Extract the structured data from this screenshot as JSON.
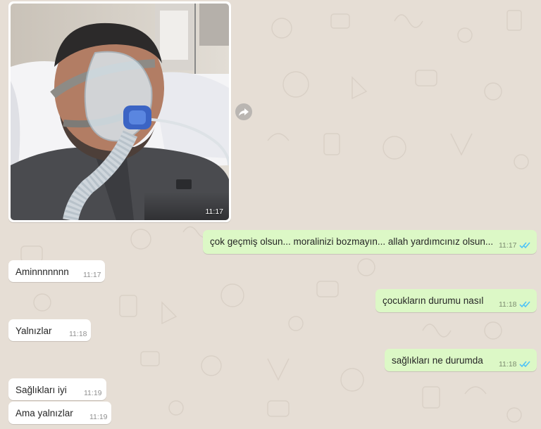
{
  "chat": {
    "photo_message": {
      "time": "11:17"
    },
    "messages": [
      {
        "direction": "out",
        "text": "çok geçmiş olsun... moralinizi bozmayın... allah yardımcınız olsun...",
        "time": "11:17",
        "status": "read"
      },
      {
        "direction": "in",
        "text": "Aminnnnnnn",
        "time": "11:17"
      },
      {
        "direction": "out",
        "text": "çocukların durumu nasıl",
        "time": "11:18",
        "status": "read"
      },
      {
        "direction": "in",
        "text": "Yalnızlar",
        "time": "11:18"
      },
      {
        "direction": "out",
        "text": "sağlıkları ne durumda",
        "time": "11:18",
        "status": "read"
      },
      {
        "direction": "in",
        "text": "Sağlıkları iyi",
        "time": "11:19"
      },
      {
        "direction": "in",
        "text": "Ama yalnızlar",
        "time": "11:19"
      }
    ]
  },
  "colors": {
    "background": "#e6ded5",
    "incoming_bubble": "#ffffff",
    "outgoing_bubble": "#dcf8c6",
    "read_ticks": "#4fc3f7"
  },
  "icons": {
    "forward": "forward-icon",
    "read_receipt": "double-check-icon"
  }
}
